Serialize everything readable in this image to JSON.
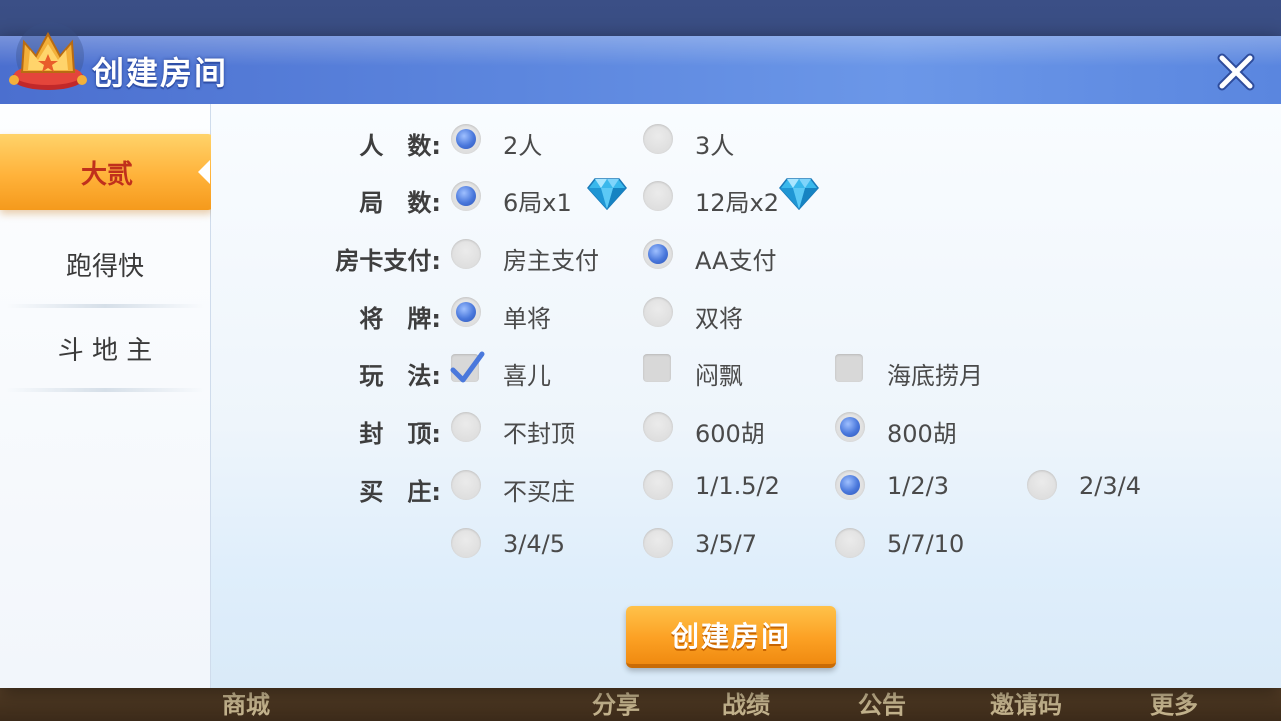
{
  "colors": {
    "title_bar": "#5c86de",
    "accent_blue": "#4a78dc",
    "active_tab": "#ffb23a",
    "active_tab_text": "#c0301c",
    "create_button": "#fca124"
  },
  "dialog": {
    "title": "创建房间",
    "close_icon": "close-icon",
    "crown_icon": "crown-icon"
  },
  "sidebar": {
    "tabs": [
      {
        "label": "大贰",
        "active": true
      },
      {
        "label": "跑得快",
        "active": false
      },
      {
        "label": "斗 地 主",
        "active": false
      }
    ]
  },
  "form": {
    "players": {
      "label": "人　数:",
      "options": [
        {
          "text": "2人",
          "checked": true
        },
        {
          "text": "3人",
          "checked": false
        }
      ]
    },
    "rounds": {
      "label": "局　数:",
      "options": [
        {
          "text": "6局x1",
          "checked": true,
          "icon": "diamond-icon"
        },
        {
          "text": "12局x2",
          "checked": false,
          "icon": "diamond-icon"
        }
      ]
    },
    "payment": {
      "label": "房卡支付:",
      "options": [
        {
          "text": "房主支付",
          "checked": false
        },
        {
          "text": "AA支付",
          "checked": true
        }
      ]
    },
    "general": {
      "label": "将　牌:",
      "options": [
        {
          "text": "单将",
          "checked": true
        },
        {
          "text": "双将",
          "checked": false
        }
      ]
    },
    "rules": {
      "label": "玩　法:",
      "options": [
        {
          "text": "喜儿",
          "checked": true
        },
        {
          "text": "闷飘",
          "checked": false
        },
        {
          "text": "海底捞月",
          "checked": false
        }
      ]
    },
    "cap": {
      "label": "封　顶:",
      "options": [
        {
          "text": "不封顶",
          "checked": false
        },
        {
          "text": "600胡",
          "checked": false
        },
        {
          "text": "800胡",
          "checked": true
        }
      ]
    },
    "buy": {
      "label": "买　庄:",
      "options": [
        {
          "text": "不买庄",
          "checked": false
        },
        {
          "text": "1/1.5/2",
          "checked": false
        },
        {
          "text": "1/2/3",
          "checked": true
        },
        {
          "text": "2/3/4",
          "checked": false
        },
        {
          "text": "3/4/5",
          "checked": false
        },
        {
          "text": "3/5/7",
          "checked": false
        },
        {
          "text": "5/7/10",
          "checked": false
        }
      ]
    }
  },
  "create_button": "创建房间",
  "background_nav": [
    "商城",
    "分享",
    "战绩",
    "公告",
    "邀请码",
    "更多"
  ]
}
